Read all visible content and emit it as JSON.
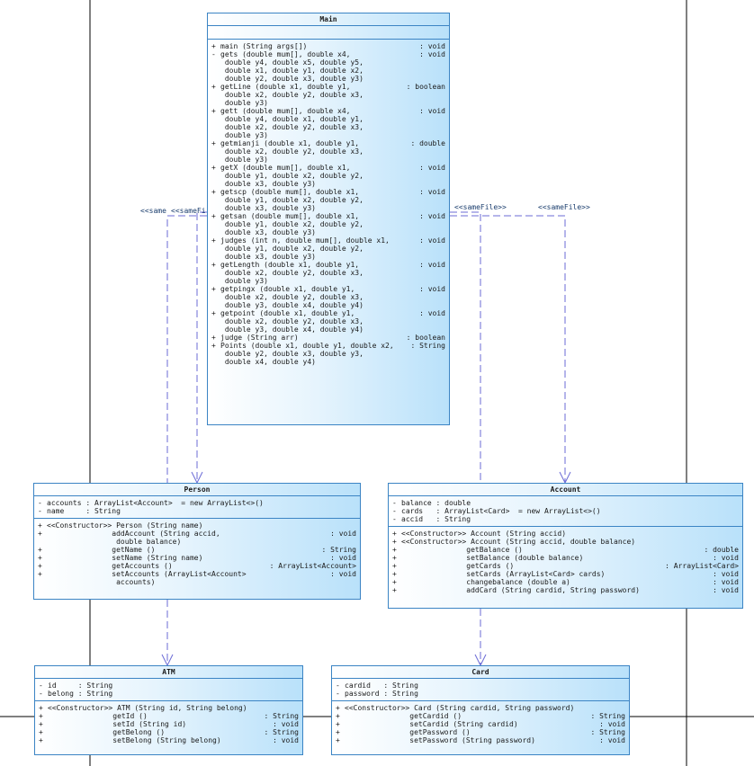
{
  "stereotype": "<<sameFile>>",
  "stereotype_clipped_1": "<<same",
  "stereotype_clipped_2": "<<sameFi",
  "classes": {
    "main": {
      "name": "Main",
      "attributes": [],
      "operations": [
        {
          "vis": "+",
          "sig": "main (String args[])",
          "ret": ": void"
        },
        {
          "vis": "-",
          "sig": "gets (double mum[], double x4,\n double y4, double x5, double y5,\n double x1, double y1, double x2,\n double y2, double x3, double y3)",
          "ret": ": void"
        },
        {
          "vis": "+",
          "sig": "getLine (double x1, double y1,\n double x2, double y2, double x3,\n double y3)",
          "ret": ": boolean"
        },
        {
          "vis": "+",
          "sig": "gett (double mum[], double x4,\n double y4, double x1, double y1,\n double x2, double y2, double x3,\n double y3)",
          "ret": ": void"
        },
        {
          "vis": "+",
          "sig": "getmianji (double x1, double y1,\n double x2, double y2, double x3,\n double y3)",
          "ret": ": double"
        },
        {
          "vis": "+",
          "sig": "getX (double mum[], double x1,\n double y1, double x2, double y2,\n double x3, double y3)",
          "ret": ": void"
        },
        {
          "vis": "+",
          "sig": "getscp (double mum[], double x1,\n double y1, double x2, double y2,\n double x3, double y3)",
          "ret": ": void"
        },
        {
          "vis": "+",
          "sig": "getsan (double mum[], double x1,\n double y1, double x2, double y2,\n double x3, double y3)",
          "ret": ": void"
        },
        {
          "vis": "+",
          "sig": "judges (int n, double mum[], double x1,\n double y1, double x2, double y2,\n double x3, double y3)",
          "ret": ": void"
        },
        {
          "vis": "+",
          "sig": "getLength (double x1, double y1,\n double x2, double y2, double x3,\n double y3)",
          "ret": ": void"
        },
        {
          "vis": "+",
          "sig": "getpingx (double x1, double y1,\n double x2, double y2, double x3,\n double y3, double x4, double y4)",
          "ret": ": void"
        },
        {
          "vis": "+",
          "sig": "getpoint (double x1, double y1,\n double x2, double y2, double x3,\n double y3, double x4, double y4)",
          "ret": ": void"
        },
        {
          "vis": "+",
          "sig": "judge (String arr)",
          "ret": ": boolean"
        },
        {
          "vis": "+",
          "sig": "Points (double x1, double y1, double x2,\n double y2, double x3, double y3,\n double x4, double y4)",
          "ret": ": String"
        }
      ]
    },
    "person": {
      "name": "Person",
      "attributes": [
        {
          "vis": "-",
          "sig": "accounts : ArrayList<Account>  = new ArrayList<>()",
          "ret": ""
        },
        {
          "vis": "-",
          "sig": "name     : String",
          "ret": ""
        }
      ],
      "operations": [
        {
          "vis": "+",
          "sig": "<<Constructor>> Person (String name)",
          "ret": ""
        },
        {
          "vis": "+",
          "sig": "               addAccount (String accid,\n                double balance)",
          "ret": ": void"
        },
        {
          "vis": "+",
          "sig": "               getName ()",
          "ret": ": String"
        },
        {
          "vis": "+",
          "sig": "               setName (String name)",
          "ret": ": void"
        },
        {
          "vis": "+",
          "sig": "               getAccounts ()",
          "ret": ": ArrayList<Account>"
        },
        {
          "vis": "+",
          "sig": "               setAccounts (ArrayList<Account>\n                accounts)",
          "ret": ": void"
        }
      ]
    },
    "account": {
      "name": "Account",
      "attributes": [
        {
          "vis": "-",
          "sig": "balance : double",
          "ret": ""
        },
        {
          "vis": "-",
          "sig": "cards   : ArrayList<Card>  = new ArrayList<>()",
          "ret": ""
        },
        {
          "vis": "-",
          "sig": "accid   : String",
          "ret": ""
        }
      ],
      "operations": [
        {
          "vis": "+",
          "sig": "<<Constructor>> Account (String accid)",
          "ret": ""
        },
        {
          "vis": "+",
          "sig": "<<Constructor>> Account (String accid, double balance)",
          "ret": ""
        },
        {
          "vis": "+",
          "sig": "               getBalance ()",
          "ret": ": double"
        },
        {
          "vis": "+",
          "sig": "               setBalance (double balance)",
          "ret": ": void"
        },
        {
          "vis": "+",
          "sig": "               getCards ()",
          "ret": ": ArrayList<Card>"
        },
        {
          "vis": "+",
          "sig": "               setCards (ArrayList<Card> cards)",
          "ret": ": void"
        },
        {
          "vis": "+",
          "sig": "               changebalance (double a)",
          "ret": ": void"
        },
        {
          "vis": "+",
          "sig": "               addCard (String cardid, String password)",
          "ret": ": void"
        }
      ]
    },
    "atm": {
      "name": "ATM",
      "attributes": [
        {
          "vis": "-",
          "sig": "id     : String",
          "ret": ""
        },
        {
          "vis": "-",
          "sig": "belong : String",
          "ret": ""
        }
      ],
      "operations": [
        {
          "vis": "+",
          "sig": "<<Constructor>> ATM (String id, String belong)",
          "ret": ""
        },
        {
          "vis": "+",
          "sig": "               getId ()",
          "ret": ": String"
        },
        {
          "vis": "+",
          "sig": "               setId (String id)",
          "ret": ": void"
        },
        {
          "vis": "+",
          "sig": "               getBelong ()",
          "ret": ": String"
        },
        {
          "vis": "+",
          "sig": "               setBelong (String belong)",
          "ret": ": void"
        }
      ]
    },
    "card": {
      "name": "Card",
      "attributes": [
        {
          "vis": "-",
          "sig": "cardid   : String",
          "ret": ""
        },
        {
          "vis": "-",
          "sig": "password : String",
          "ret": ""
        }
      ],
      "operations": [
        {
          "vis": "+",
          "sig": "<<Constructor>> Card (String cardid, String password)",
          "ret": ""
        },
        {
          "vis": "+",
          "sig": "               getCardid ()",
          "ret": ": String"
        },
        {
          "vis": "+",
          "sig": "               setCardid (String cardid)",
          "ret": ": void"
        },
        {
          "vis": "+",
          "sig": "               getPassword ()",
          "ret": ": String"
        },
        {
          "vis": "+",
          "sig": "               setPassword (String password)",
          "ret": ": void"
        }
      ]
    }
  },
  "colors": {
    "border": "#3b84c4",
    "dependency": "#6b6bd6",
    "frame": "#000000"
  }
}
